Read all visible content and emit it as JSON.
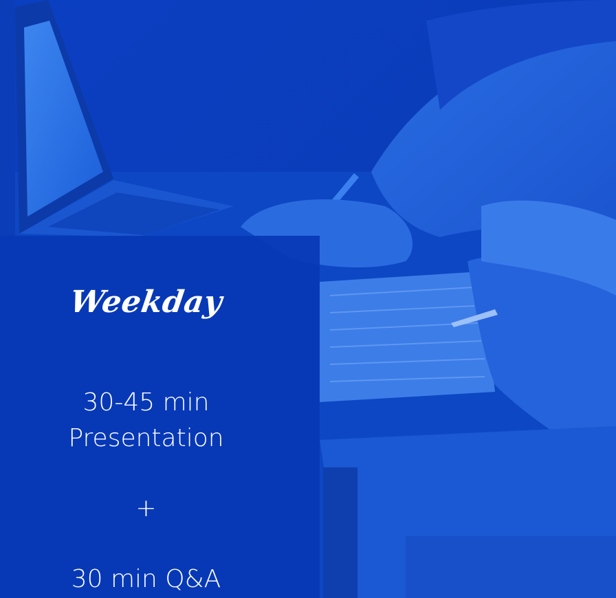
{
  "panel": {
    "title": "Weekday",
    "duration": "30-45 min",
    "format": "Presentation",
    "separator": "+",
    "qa": "30 min Q&A"
  }
}
